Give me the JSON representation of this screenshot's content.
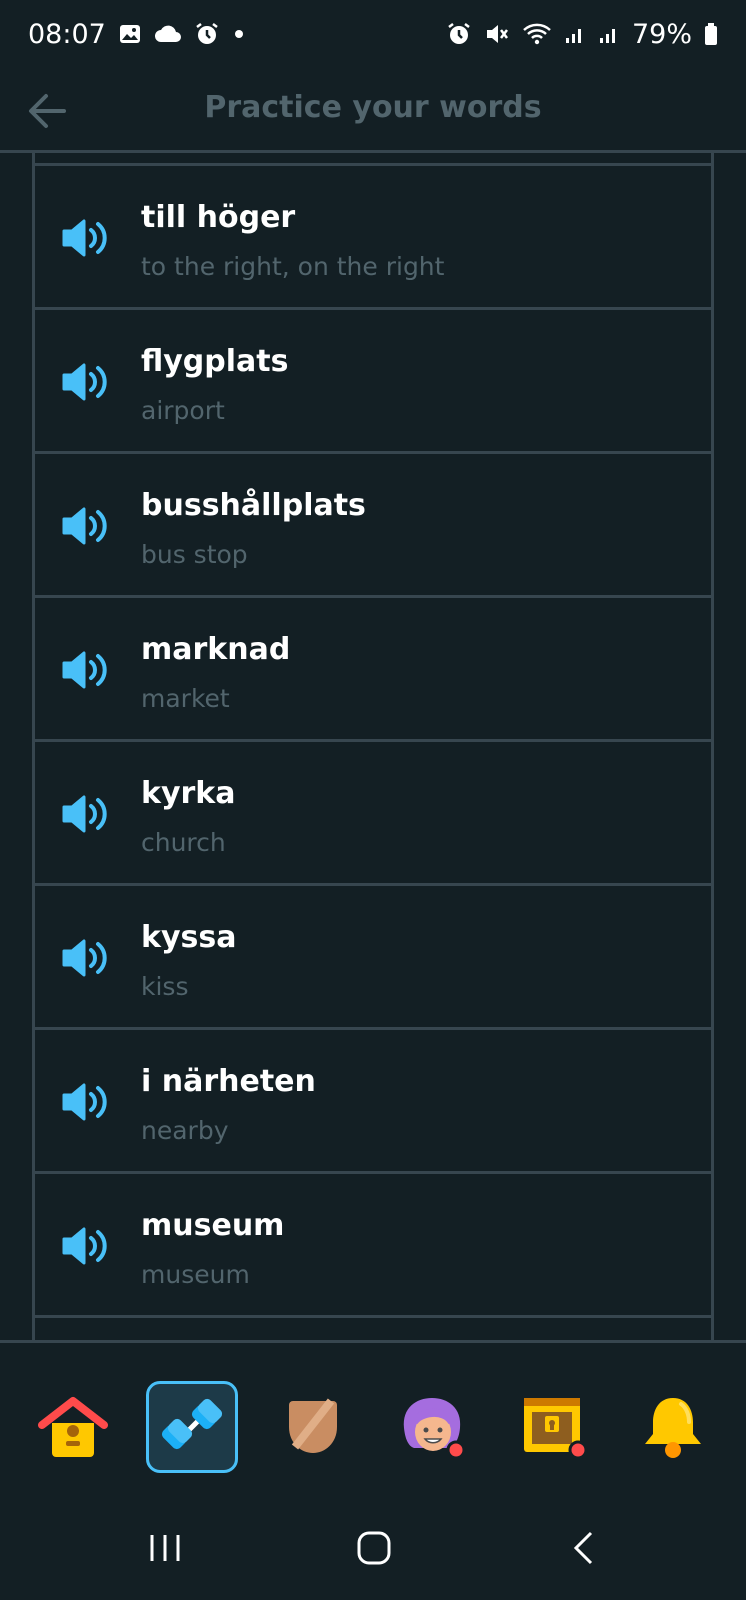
{
  "status_bar": {
    "time": "08:07",
    "battery": "79%",
    "left_icons": [
      "gallery-icon",
      "cloud-icon",
      "alarm-icon",
      "dot-icon"
    ],
    "right_icons": [
      "alarm-icon",
      "mute-icon",
      "wifi-icon",
      "signal-icon",
      "signal-icon",
      "battery-icon"
    ]
  },
  "header": {
    "title": "Practice your words",
    "back_icon": "arrow-left-icon"
  },
  "words": [
    {
      "word": "till höger",
      "translation": "to the right, on the right"
    },
    {
      "word": "flygplats",
      "translation": "airport"
    },
    {
      "word": "busshållplats",
      "translation": "bus stop"
    },
    {
      "word": "marknad",
      "translation": "market"
    },
    {
      "word": "kyrka",
      "translation": "church"
    },
    {
      "word": "kyssa",
      "translation": "kiss"
    },
    {
      "word": "i närheten",
      "translation": "nearby"
    },
    {
      "word": "museum",
      "translation": "museum"
    }
  ],
  "bottom_nav": [
    {
      "icon": "home-icon",
      "active": false
    },
    {
      "icon": "practice-dumbbell-icon",
      "active": true
    },
    {
      "icon": "league-shield-icon",
      "active": false
    },
    {
      "icon": "profile-avatar-icon",
      "active": false
    },
    {
      "icon": "treasure-chest-icon",
      "active": false
    },
    {
      "icon": "bell-icon",
      "active": false
    }
  ],
  "colors": {
    "background": "#131f24",
    "border": "#37464f",
    "muted_text": "#52656d",
    "accent_blue": "#49c0f8"
  }
}
